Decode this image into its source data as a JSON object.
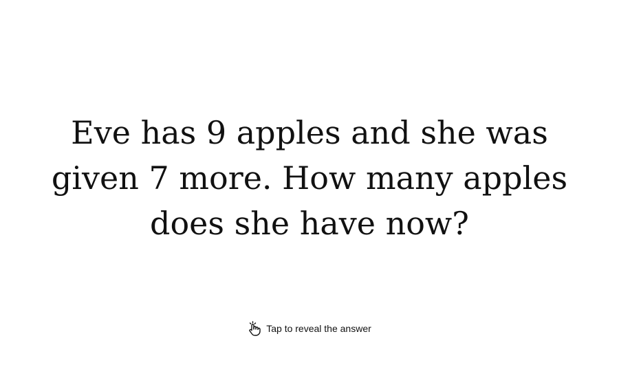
{
  "flashcard": {
    "question": "Eve has 9 apples and she was given 7 more. How many apples does she have now?",
    "reveal_label": "Tap to reveal the answer",
    "reveal_icon": "tap-hand-icon"
  }
}
